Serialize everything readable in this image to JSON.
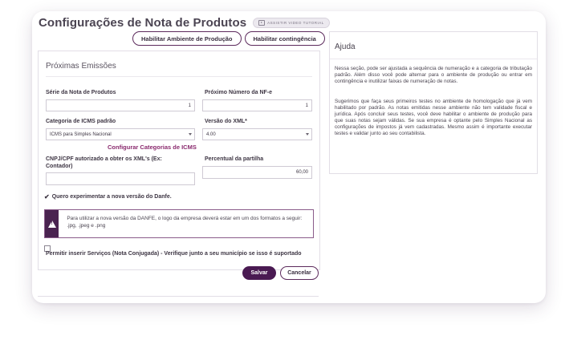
{
  "header": {
    "title": "Configurações de Nota de Produtos",
    "video_badge": "ASSISTIR VIDEO TUTORIAL"
  },
  "env_buttons": {
    "production": "Habilitar Ambiente de Produção",
    "contingency": "Habilitar contingência"
  },
  "form": {
    "section_title": "Próximas Emissões",
    "serie_label": "Série da Nota de Produtos",
    "serie_value": "1",
    "next_number_label": "Próximo Número da NF-e",
    "next_number_value": "1",
    "icms_label": "Categoria de ICMS padrão",
    "icms_value": "ICMS para Simples Nacional",
    "xml_version_label": "Versão do XML*",
    "xml_version_value": "4.00",
    "icms_link": "Configurar Categorias de ICMS",
    "cnpj_label": "CNPJ/CPF autorizado a obter os XML's (Ex: Contador)",
    "cnpj_value": "",
    "partilha_label": "Percentual da partilha",
    "partilha_value": "60,00",
    "danfe_checkbox_label": "Quero experimentar a nova versão do Danfe.",
    "warning_text": "Para utilizar a nova versão da DANFE, o logo da empresa deverá estar em um dos formatos a seguir: .jpg, .jpeg e .png",
    "services_label": "Permitir inserir Serviços (Nota Conjugada) - Verifique junto a seu município se isso é suportado"
  },
  "actions": {
    "save": "Salvar",
    "cancel": "Cancelar"
  },
  "help": {
    "title": "Ajuda",
    "p1": "Nessa seção, pode ser ajustada a sequência de numeração e a categoria de tributação padrão. Além disso você pode alternar para o ambiente de produção ou entrar em contingência e inutilizar faixas de numeração de notas.",
    "p2": "Sugerimos que faça seus primeiros testes no ambiente de homologação que já vem habilitado por padrão. As notas emitidas nesse ambiente não tem validade fiscal e jurídica. Após concluir seus testes, você deve habilitar o ambiente de produção para que suas notas sejam válidas. Se sua empresa é optante pelo Simples Nacional as configurações de impostos já vem cadastradas. Mesmo assim é importante executar testes e validar junto ao seu contabilista."
  },
  "colors": {
    "accent": "#4a1a52",
    "link": "#8a2a6e"
  }
}
